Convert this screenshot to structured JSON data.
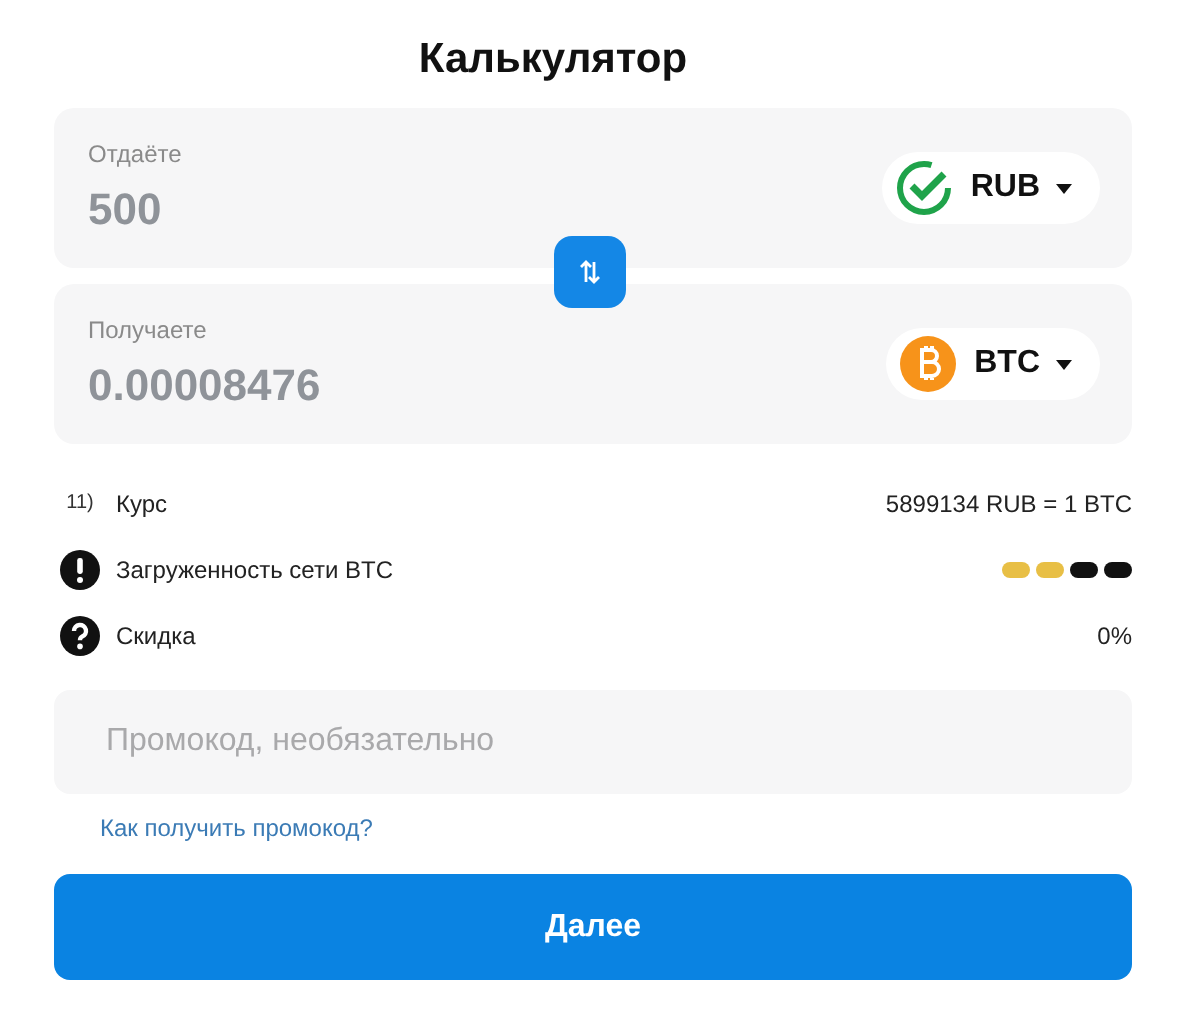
{
  "title": "Калькулятор",
  "give": {
    "label": "Отдаёте",
    "value": "500",
    "currency": "RUB",
    "kind": "sber"
  },
  "receive": {
    "label": "Получаете",
    "value": "0.00008476",
    "currency": "BTC",
    "kind": "btc"
  },
  "info": [
    {
      "kind": "rate",
      "icon_text": "11)",
      "label": "Курс",
      "value": "5899134 RUB = 1 BTC"
    },
    {
      "kind": "load",
      "label": "Загруженность сети BTC",
      "segments": [
        {
          "color": "#e8bf45"
        },
        {
          "color": "#e8bf45"
        },
        {
          "color": "#111111"
        },
        {
          "color": "#111111"
        }
      ]
    },
    {
      "kind": "discount",
      "label": "Скидка",
      "value": "0%"
    }
  ],
  "promo": {
    "placeholder": "Промокод, необязательно"
  },
  "promo_link": "Как получить промокод?",
  "submit": "Далее"
}
